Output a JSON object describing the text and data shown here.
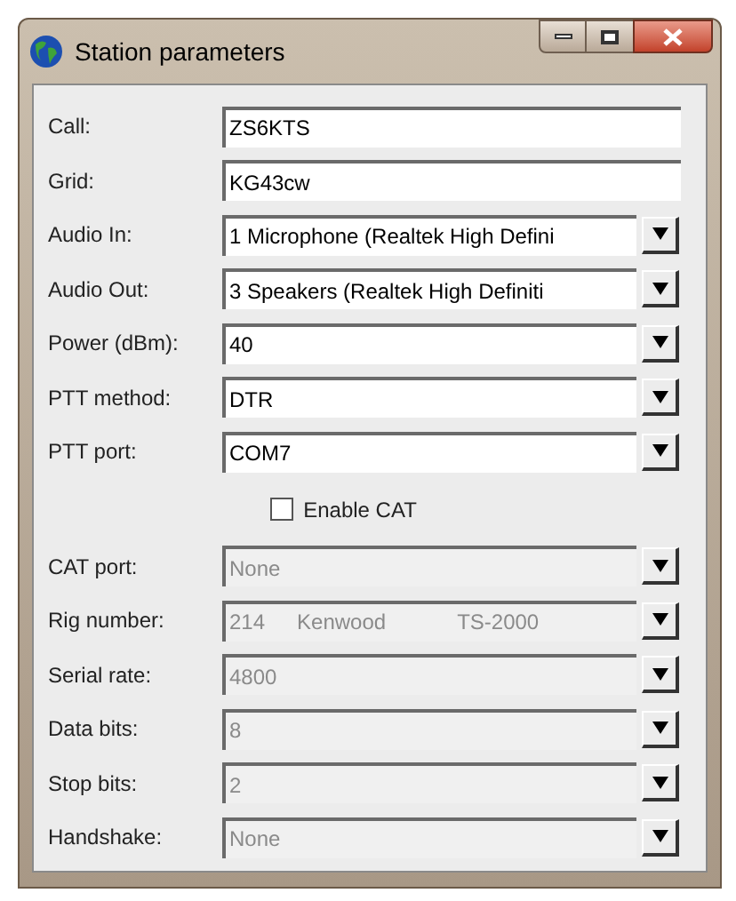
{
  "window": {
    "title": "Station parameters"
  },
  "rows": [
    {
      "kind": "text",
      "label": "Call:",
      "value": "ZS6KTS",
      "disabled": false
    },
    {
      "kind": "text",
      "label": "Grid:",
      "value": "KG43cw",
      "disabled": false
    },
    {
      "kind": "combo",
      "label": "Audio In:",
      "value": "1 Microphone (Realtek High Defini",
      "disabled": false
    },
    {
      "kind": "combo",
      "label": "Audio Out:",
      "value": "3 Speakers (Realtek High Definiti",
      "disabled": false
    },
    {
      "kind": "combo",
      "label": "Power (dBm):",
      "value": "40",
      "disabled": false
    },
    {
      "kind": "combo",
      "label": "PTT method:",
      "value": "DTR",
      "disabled": false
    },
    {
      "kind": "combo",
      "label": "PTT port:",
      "value": "COM7",
      "disabled": false
    },
    {
      "kind": "checkbox",
      "label": "Enable CAT",
      "checked": false
    },
    {
      "kind": "combo",
      "label": "CAT port:",
      "value": "None",
      "disabled": true
    },
    {
      "kind": "combo",
      "label": "Rig number:",
      "value_columns": [
        "214",
        "Kenwood",
        "TS-2000"
      ],
      "disabled": true
    },
    {
      "kind": "combo",
      "label": "Serial rate:",
      "value": "4800",
      "disabled": true
    },
    {
      "kind": "combo",
      "label": "Data bits:",
      "value": "8",
      "disabled": true
    },
    {
      "kind": "combo",
      "label": "Stop bits:",
      "value": "2",
      "disabled": true
    },
    {
      "kind": "combo",
      "label": "Handshake:",
      "value": "None",
      "disabled": true
    }
  ]
}
